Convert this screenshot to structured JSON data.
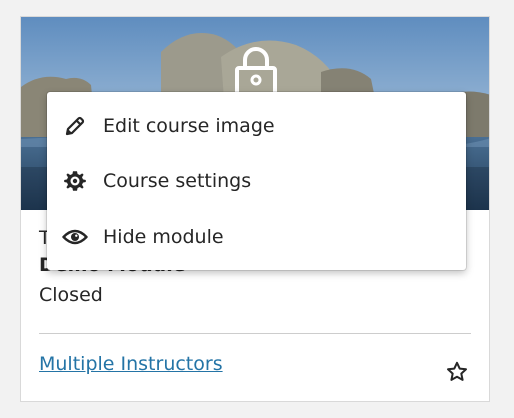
{
  "card": {
    "course_id_partial": "T",
    "course_title": "Demo Module",
    "status": "Closed",
    "instructors_link": "Multiple Instructors",
    "favorite_icon": "star-outline-icon",
    "lock_icon": "lock-icon"
  },
  "menu": {
    "items": [
      {
        "label": "Edit course image",
        "icon": "pencil-icon"
      },
      {
        "label": "Course settings",
        "icon": "gear-icon"
      },
      {
        "label": "Hide module",
        "icon": "eye-icon"
      }
    ]
  },
  "colors": {
    "link": "#2474a6",
    "text": "#262626",
    "divider": "#cdcdcd"
  }
}
